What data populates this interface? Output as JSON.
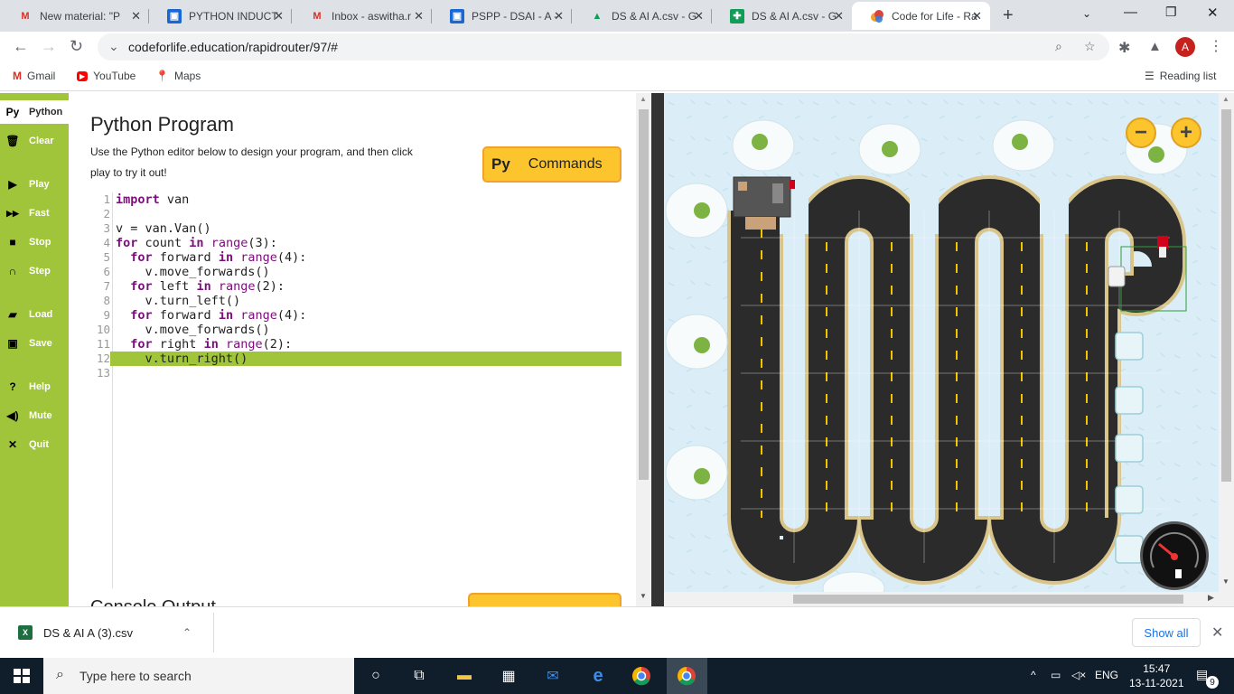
{
  "browser": {
    "tabs": [
      {
        "label": "New material: \"P",
        "favicon": "gmail-icon"
      },
      {
        "label": "PYTHON INDUCT",
        "favicon": "classroom-icon"
      },
      {
        "label": "Inbox - aswitha.r",
        "favicon": "gmail-icon"
      },
      {
        "label": "PSPP - DSAI - A -",
        "favicon": "classroom-icon"
      },
      {
        "label": "DS & AI A.csv - G",
        "favicon": "drive-icon"
      },
      {
        "label": "DS & AI A.csv - G",
        "favicon": "sheets-icon"
      },
      {
        "label": "Code for Life - Ra",
        "favicon": "codeforlife-icon"
      }
    ],
    "url": "codeforlife.education/rapidrouter/97/#",
    "profile_initial": "A",
    "bookmarks": [
      {
        "label": "Gmail",
        "icon": "gmail-icon"
      },
      {
        "label": "YouTube",
        "icon": "youtube-icon"
      },
      {
        "label": "Maps",
        "icon": "maps-icon"
      }
    ],
    "reading_list": "Reading list"
  },
  "sidebar": {
    "items": [
      {
        "label": "Python",
        "icon": "Py",
        "active": true
      },
      {
        "label": "Clear",
        "icon": "trash-icon"
      },
      {
        "label": "Play",
        "icon": "play-icon"
      },
      {
        "label": "Fast",
        "icon": "fast-forward-icon"
      },
      {
        "label": "Stop",
        "icon": "stop-icon"
      },
      {
        "label": "Step",
        "icon": "step-icon"
      },
      {
        "label": "Load",
        "icon": "folder-icon"
      },
      {
        "label": "Save",
        "icon": "save-icon"
      },
      {
        "label": "Help",
        "icon": "help-icon"
      },
      {
        "label": "Mute",
        "icon": "speaker-icon"
      },
      {
        "label": "Quit",
        "icon": "close-icon"
      }
    ]
  },
  "editor": {
    "title": "Python Program",
    "description": "Use the Python editor below to design your program, and then click play to try it out!",
    "commands_button": {
      "prefix": "Py",
      "label": "Commands"
    },
    "highlighted_line": 12,
    "lines": [
      "import van",
      "",
      "v = van.Van()",
      "for count in range(3):",
      "  for forward in range(4):",
      "    v.move_forwards()",
      "  for left in range(2):",
      "    v.turn_left()",
      "  for forward in range(4):",
      "    v.move_forwards()",
      "  for right in range(2):",
      "    v.turn_right()",
      ""
    ],
    "console_title": "Console Output"
  },
  "map": {
    "zoom_out": "−",
    "zoom_in": "+",
    "colors": {
      "background": "#dbeef7",
      "road": "#2b2b2b",
      "road_edge": "#d9c48a",
      "lane_marking": "#f5c400",
      "grass": "#a0c53a"
    }
  },
  "downloads": {
    "file": "DS & AI A (3).csv",
    "show_all": "Show all"
  },
  "taskbar": {
    "search_placeholder": "Type here to search",
    "language": "ENG",
    "time": "15:47",
    "date": "13-11-2021",
    "notifications": "9"
  }
}
